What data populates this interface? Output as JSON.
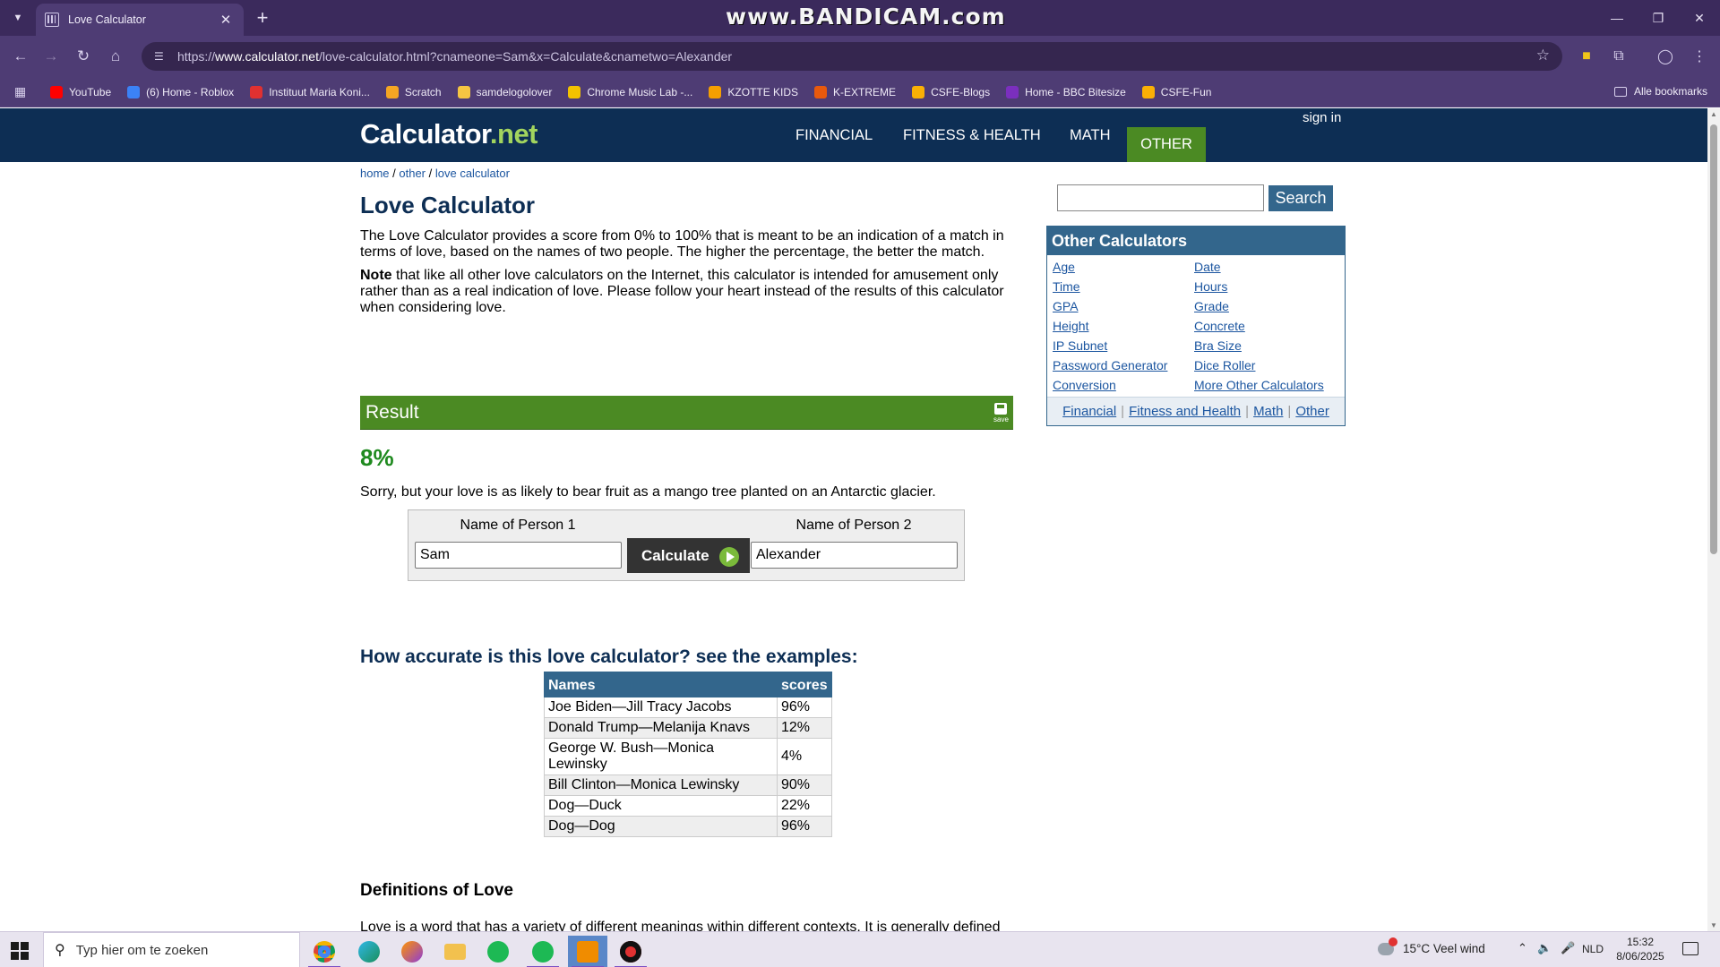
{
  "browser": {
    "tab_title": "Love Calculator",
    "watermark": "www.BANDICAM.com",
    "url_prefix": "https://",
    "url_host": "www.calculator.net",
    "url_path": "/love-calculator.html?cnameone=Sam&x=Calculate&cnametwo=Alexander",
    "bookmarks": [
      {
        "label": "YouTube",
        "color": "#ff0000"
      },
      {
        "label": "(6) Home - Roblox",
        "color": "#3b82f6"
      },
      {
        "label": "Instituut Maria Koni...",
        "color": "#e03131"
      },
      {
        "label": "Scratch",
        "color": "#f5a623"
      },
      {
        "label": "samdelogolover",
        "color": "#f5c542"
      },
      {
        "label": "Chrome Music Lab -...",
        "color": "#f2c200"
      },
      {
        "label": "KZOTTE KIDS",
        "color": "#f59f00"
      },
      {
        "label": "K-EXTREME",
        "color": "#e8590c"
      },
      {
        "label": "CSFE-Blogs",
        "color": "#fab005"
      },
      {
        "label": "Home - BBC Bitesize",
        "color": "#7b2fbe"
      },
      {
        "label": "CSFE-Fun",
        "color": "#fab005"
      }
    ],
    "all_bookmarks": "Alle bookmarks"
  },
  "site": {
    "logo_main": "Calculator",
    "logo_accent": ".net",
    "nav": [
      "FINANCIAL",
      "FITNESS & HEALTH",
      "MATH",
      "OTHER"
    ],
    "sign_in": "sign in"
  },
  "breadcrumb": [
    "home",
    "other",
    "love calculator"
  ],
  "page": {
    "title": "Love Calculator",
    "intro": "The Love Calculator provides a score from 0% to 100% that is meant to be an indication of a match in terms of love, based on the names of two people. The higher the percentage, the better the match.",
    "note_bold": "Note",
    "note_rest": " that like all other love calculators on the Internet, this calculator is intended for amusement only rather than as a real indication of love. Please follow your heart instead of the results of this calculator when considering love.",
    "result_label": "Result",
    "save_label": "save",
    "score": "8%",
    "verdict": "Sorry, but your love is as likely to bear fruit as a mango tree planted on an Antarctic glacier."
  },
  "form": {
    "person1_label": "Name of Person 1",
    "person2_label": "Name of Person 2",
    "person1_value": "Sam",
    "person2_value": "Alexander",
    "calculate_label": "Calculate"
  },
  "examples": {
    "title": "How accurate is this love calculator? see the examples:",
    "headers": [
      "Names",
      "scores"
    ],
    "rows": [
      [
        "Joe Biden—Jill Tracy Jacobs",
        "96%"
      ],
      [
        "Donald Trump—Melanija Knavs",
        "12%"
      ],
      [
        "George W. Bush—Monica Lewinsky",
        "4%"
      ],
      [
        "Bill Clinton—Monica Lewinsky",
        "90%"
      ],
      [
        "Dog—Duck",
        "22%"
      ],
      [
        "Dog—Dog",
        "96%"
      ]
    ]
  },
  "definitions": {
    "title": "Definitions of Love",
    "text": "Love is a word that has a variety of different meanings within different contexts. It is generally defined as a strong affection for another person, be it maternal, sexual, or based on admiration, and is sometimes even extended to objects or even food. There are differences in the concept of love even between cultures and countries, making it difficult to arrive at a \"universal\" definition of love."
  },
  "sidebar": {
    "search_label": "Search",
    "other_title": "Other Calculators",
    "links_left": [
      "Age",
      "Time",
      "GPA",
      "Height",
      "IP Subnet",
      "Password Generator",
      "Conversion"
    ],
    "links_right": [
      "Date",
      "Hours",
      "Grade",
      "Concrete",
      "Bra Size",
      "Dice Roller",
      "More Other Calculators"
    ],
    "footer_links": [
      "Financial",
      "Fitness and Health",
      "Math",
      "Other"
    ]
  },
  "taskbar": {
    "search_placeholder": "Typ hier om te zoeken",
    "weather": "15°C  Veel wind",
    "language": "NLD",
    "time": "15:32",
    "date": "8/06/2025"
  },
  "colors": {
    "site_header": "#0d2e54",
    "result_green": "#4b8a23",
    "score_green": "#1f8a1f",
    "table_header": "#33668c"
  }
}
